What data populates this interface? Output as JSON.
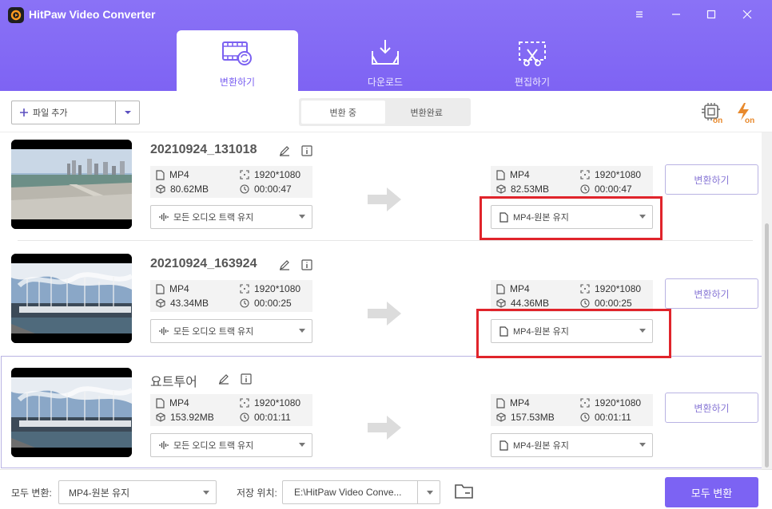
{
  "app": {
    "title": "HitPaw Video Converter"
  },
  "nav": {
    "tabs": [
      {
        "label": "변환하기"
      },
      {
        "label": "다운로드"
      },
      {
        "label": "편집하기"
      }
    ]
  },
  "toolbar": {
    "add_file_label": "파일 추가",
    "segments": [
      "변환 중",
      "변환완료"
    ],
    "gpu_badge": "on",
    "speed_badge": "on"
  },
  "files": [
    {
      "name": "20210924_131018",
      "input": {
        "format": "MP4",
        "size": "80.62MB",
        "resolution": "1920*1080",
        "duration": "00:00:47"
      },
      "output": {
        "format": "MP4",
        "size": "82.53MB",
        "resolution": "1920*1080",
        "duration": "00:00:47"
      },
      "audio_option": "모든 오디오 트랙 유지",
      "output_option": "MP4-원본 유지",
      "convert_label": "변환하기"
    },
    {
      "name": "20210924_163924",
      "input": {
        "format": "MP4",
        "size": "43.34MB",
        "resolution": "1920*1080",
        "duration": "00:00:25"
      },
      "output": {
        "format": "MP4",
        "size": "44.36MB",
        "resolution": "1920*1080",
        "duration": "00:00:25"
      },
      "audio_option": "모든 오디오 트랙 유지",
      "output_option": "MP4-원본 유지",
      "convert_label": "변환하기"
    },
    {
      "name": "요트투어",
      "input": {
        "format": "MP4",
        "size": "153.92MB",
        "resolution": "1920*1080",
        "duration": "00:01:11"
      },
      "output": {
        "format": "MP4",
        "size": "157.53MB",
        "resolution": "1920*1080",
        "duration": "00:01:11"
      },
      "audio_option": "모든 오디오 트랙 유지",
      "output_option": "MP4-원본 유지",
      "convert_label": "변환하기"
    }
  ],
  "footer": {
    "convert_all_to_label": "모두 변환:",
    "convert_all_to_value": "MP4-원본 유지",
    "save_location_label": "저장 위치:",
    "save_location_value": "E:\\HitPaw Video Conve...",
    "convert_all_button": "모두 변환"
  },
  "colors": {
    "accent": "#7c63f3",
    "highlight": "#e0242b",
    "badge": "#e8892c"
  }
}
